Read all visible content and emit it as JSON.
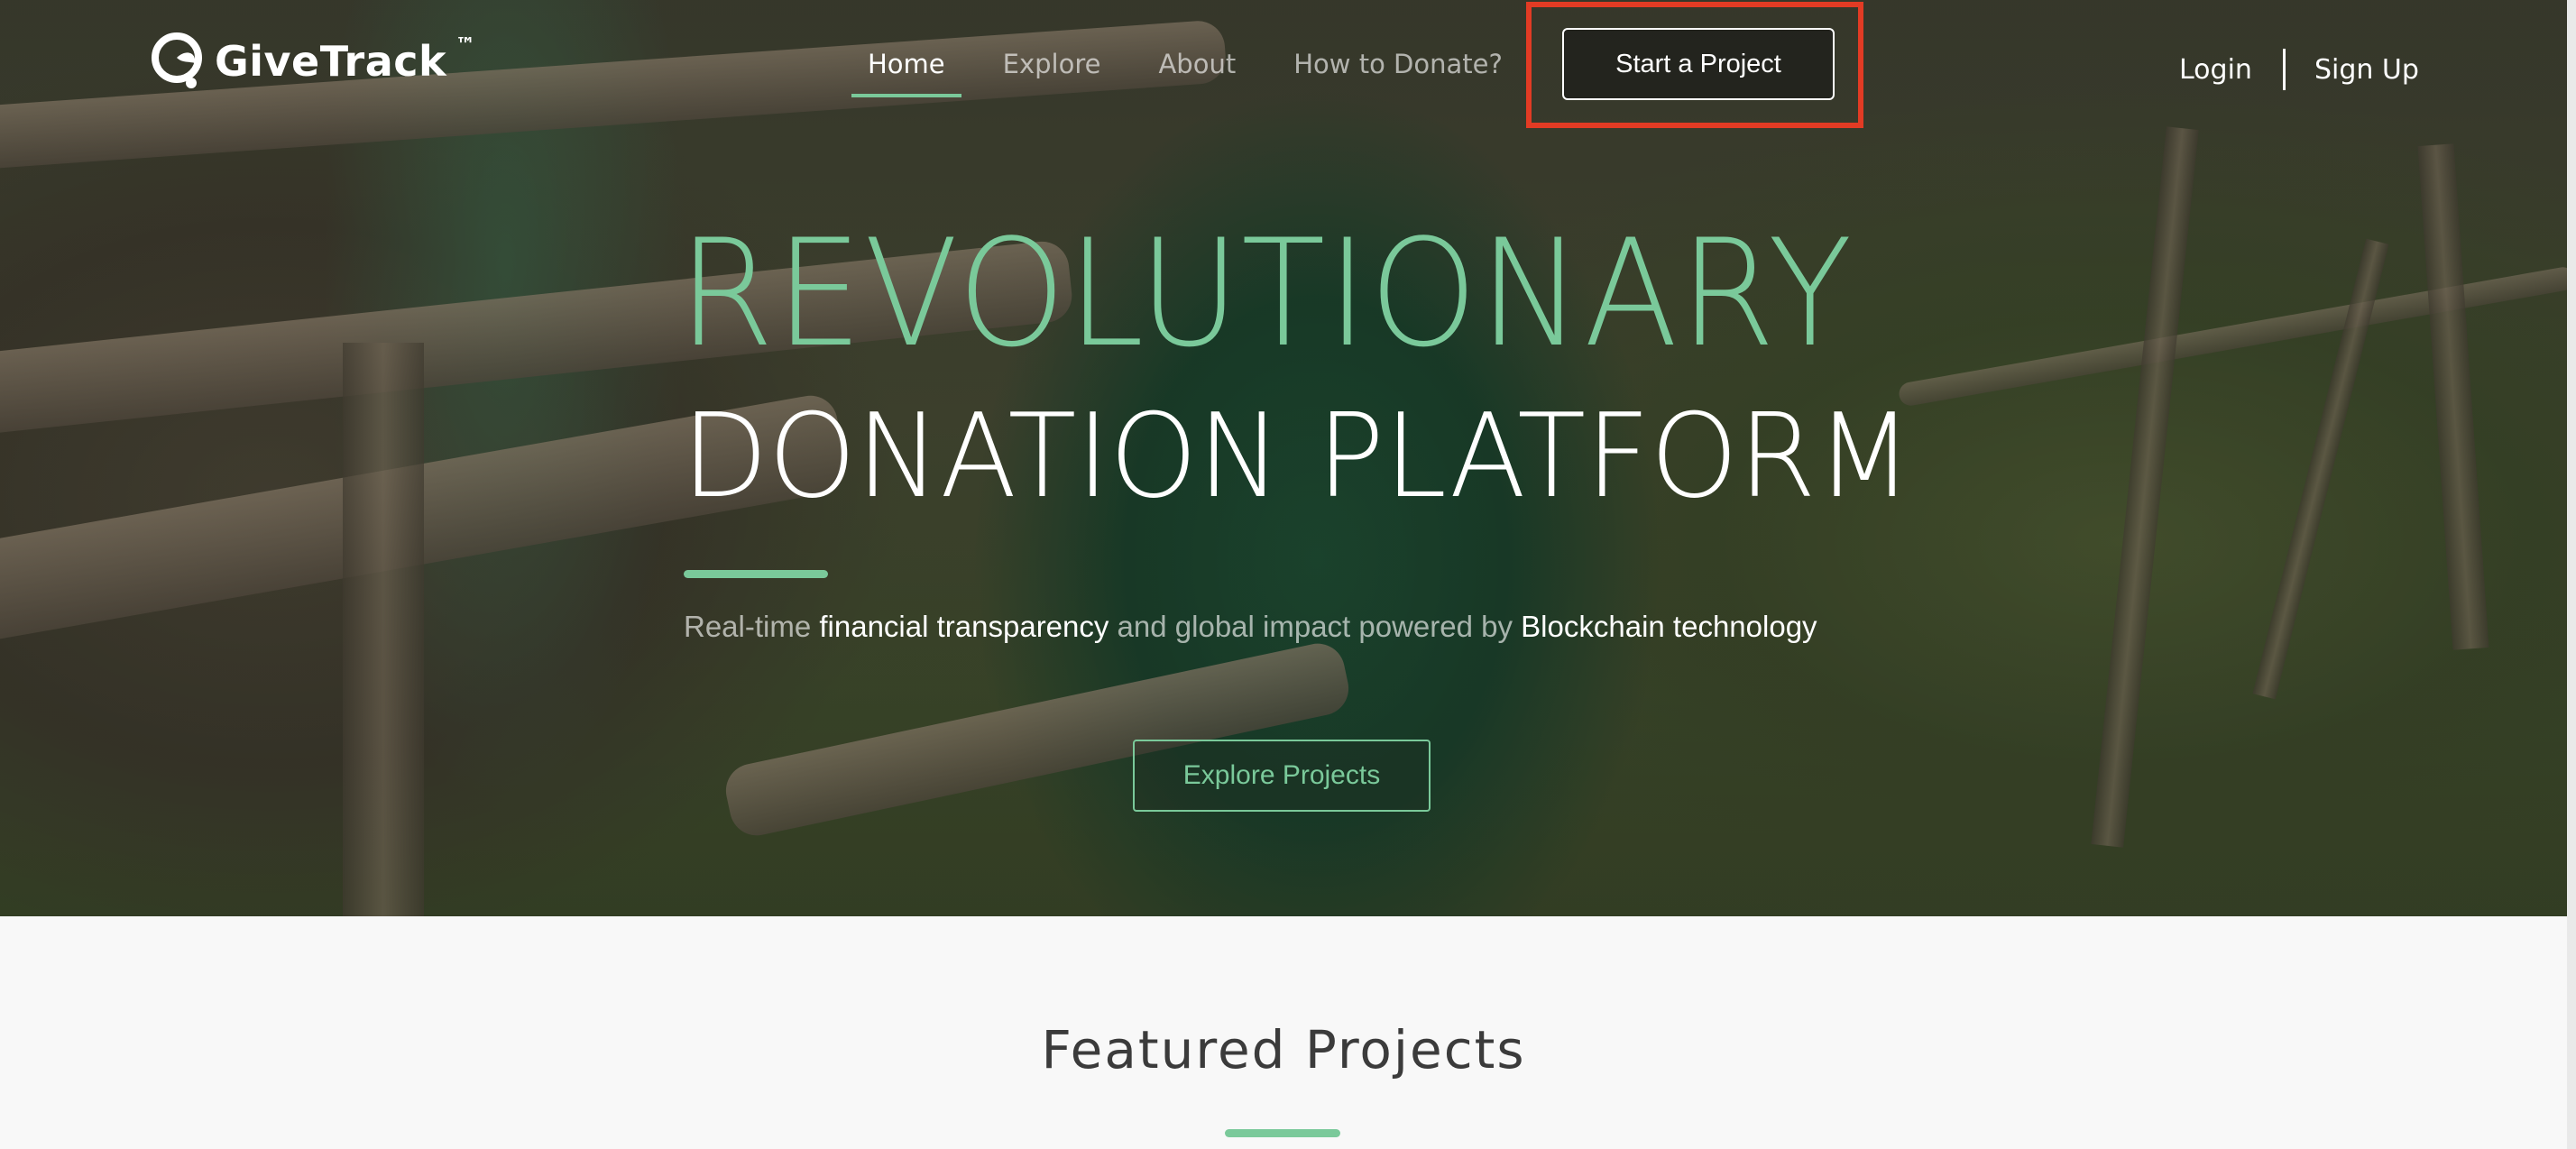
{
  "brand": {
    "name": "GiveTrack",
    "trademark": "™",
    "accent_color": "#7ac99a"
  },
  "nav": {
    "items": [
      {
        "label": "Home",
        "active": true
      },
      {
        "label": "Explore",
        "active": false
      },
      {
        "label": "About",
        "active": false
      },
      {
        "label": "How to Donate?",
        "active": false
      }
    ],
    "cta_label": "Start a Project",
    "login_label": "Login",
    "signup_label": "Sign Up"
  },
  "hero": {
    "headline_1": "REVOLUTIONARY",
    "headline_2": "DONATION PLATFORM",
    "tagline_parts": [
      {
        "text": "Real-time ",
        "strong": false
      },
      {
        "text": "financial transparency",
        "strong": true
      },
      {
        "text": " and global impact powered by ",
        "strong": false
      },
      {
        "text": "Blockchain technology",
        "strong": true
      }
    ],
    "cta_label": "Explore Projects"
  },
  "featured": {
    "title": "Featured Projects"
  },
  "annotation": {
    "highlight_color": "#e23b24"
  }
}
